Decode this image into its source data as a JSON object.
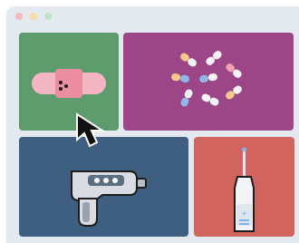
{
  "window": {
    "background": "#e4e9f0",
    "controls": [
      "close-dot",
      "minimize-dot",
      "maximize-dot"
    ]
  },
  "tiles": [
    {
      "name": "bandage",
      "icon": "bandage-icon",
      "color": "#5d9b6d"
    },
    {
      "name": "pills",
      "icon": "pills-icon",
      "color": "#9c4587"
    },
    {
      "name": "thermometer",
      "icon": "thermometer-icon",
      "color": "#3e5f80"
    },
    {
      "name": "syringe",
      "icon": "syringe-icon",
      "color": "#d2645e"
    }
  ],
  "cursor": {
    "icon": "arrow-cursor-icon"
  }
}
